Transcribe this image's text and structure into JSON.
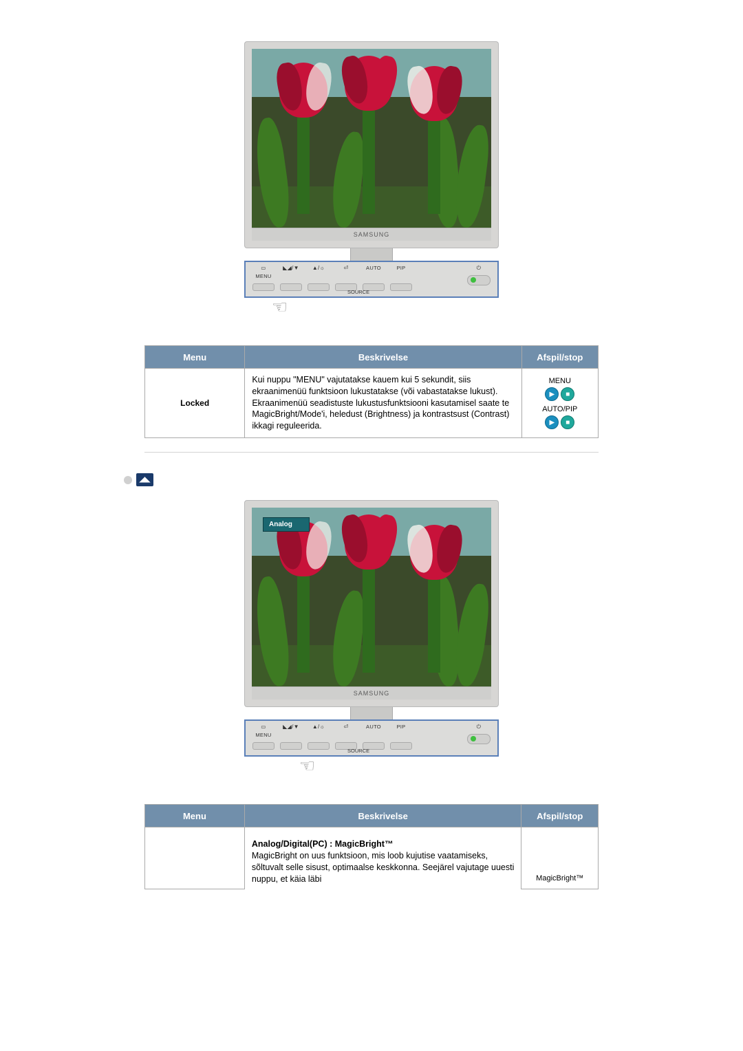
{
  "monitor": {
    "brand": "SAMSUNG",
    "buttons": {
      "menu": "MENU",
      "mode": "▲/▼",
      "bright": "▲/☼",
      "enter": "⏎",
      "auto": "AUTO",
      "pip": "PIP",
      "power": "⏻",
      "source": "SOURCE"
    },
    "overlay": {
      "analog": "Analog"
    }
  },
  "table_headers": {
    "menu": "Menu",
    "description": "Beskrivelse",
    "play_stop": "Afspil/stop"
  },
  "table1": {
    "menu": "Locked",
    "description": "Kui nuppu \"MENU\" vajutatakse kauem kui 5 sekundit, siis ekraanimenüü funktsioon lukustatakse (või vabastatakse lukust). Ekraanimenüü seadistuste lukustusfunktsiooni kasutamisel saate te MagicBright/Mode'i, heledust (Brightness) ja kontrastsust (Contrast) ikkagi reguleerida.",
    "play": {
      "group1_label": "MENU",
      "group2_label": "AUTO/PIP"
    }
  },
  "table2": {
    "menu": "",
    "desc_title": "Analog/Digital(PC) : MagicBright™",
    "description": "MagicBright on uus funktsioon, mis loob kujutise vaatamiseks, sõltuvalt selle sisust, optimaalse keskkonna. Seejärel vajutage uuesti nuppu, et käia läbi",
    "play_label": "MagicBright™"
  }
}
